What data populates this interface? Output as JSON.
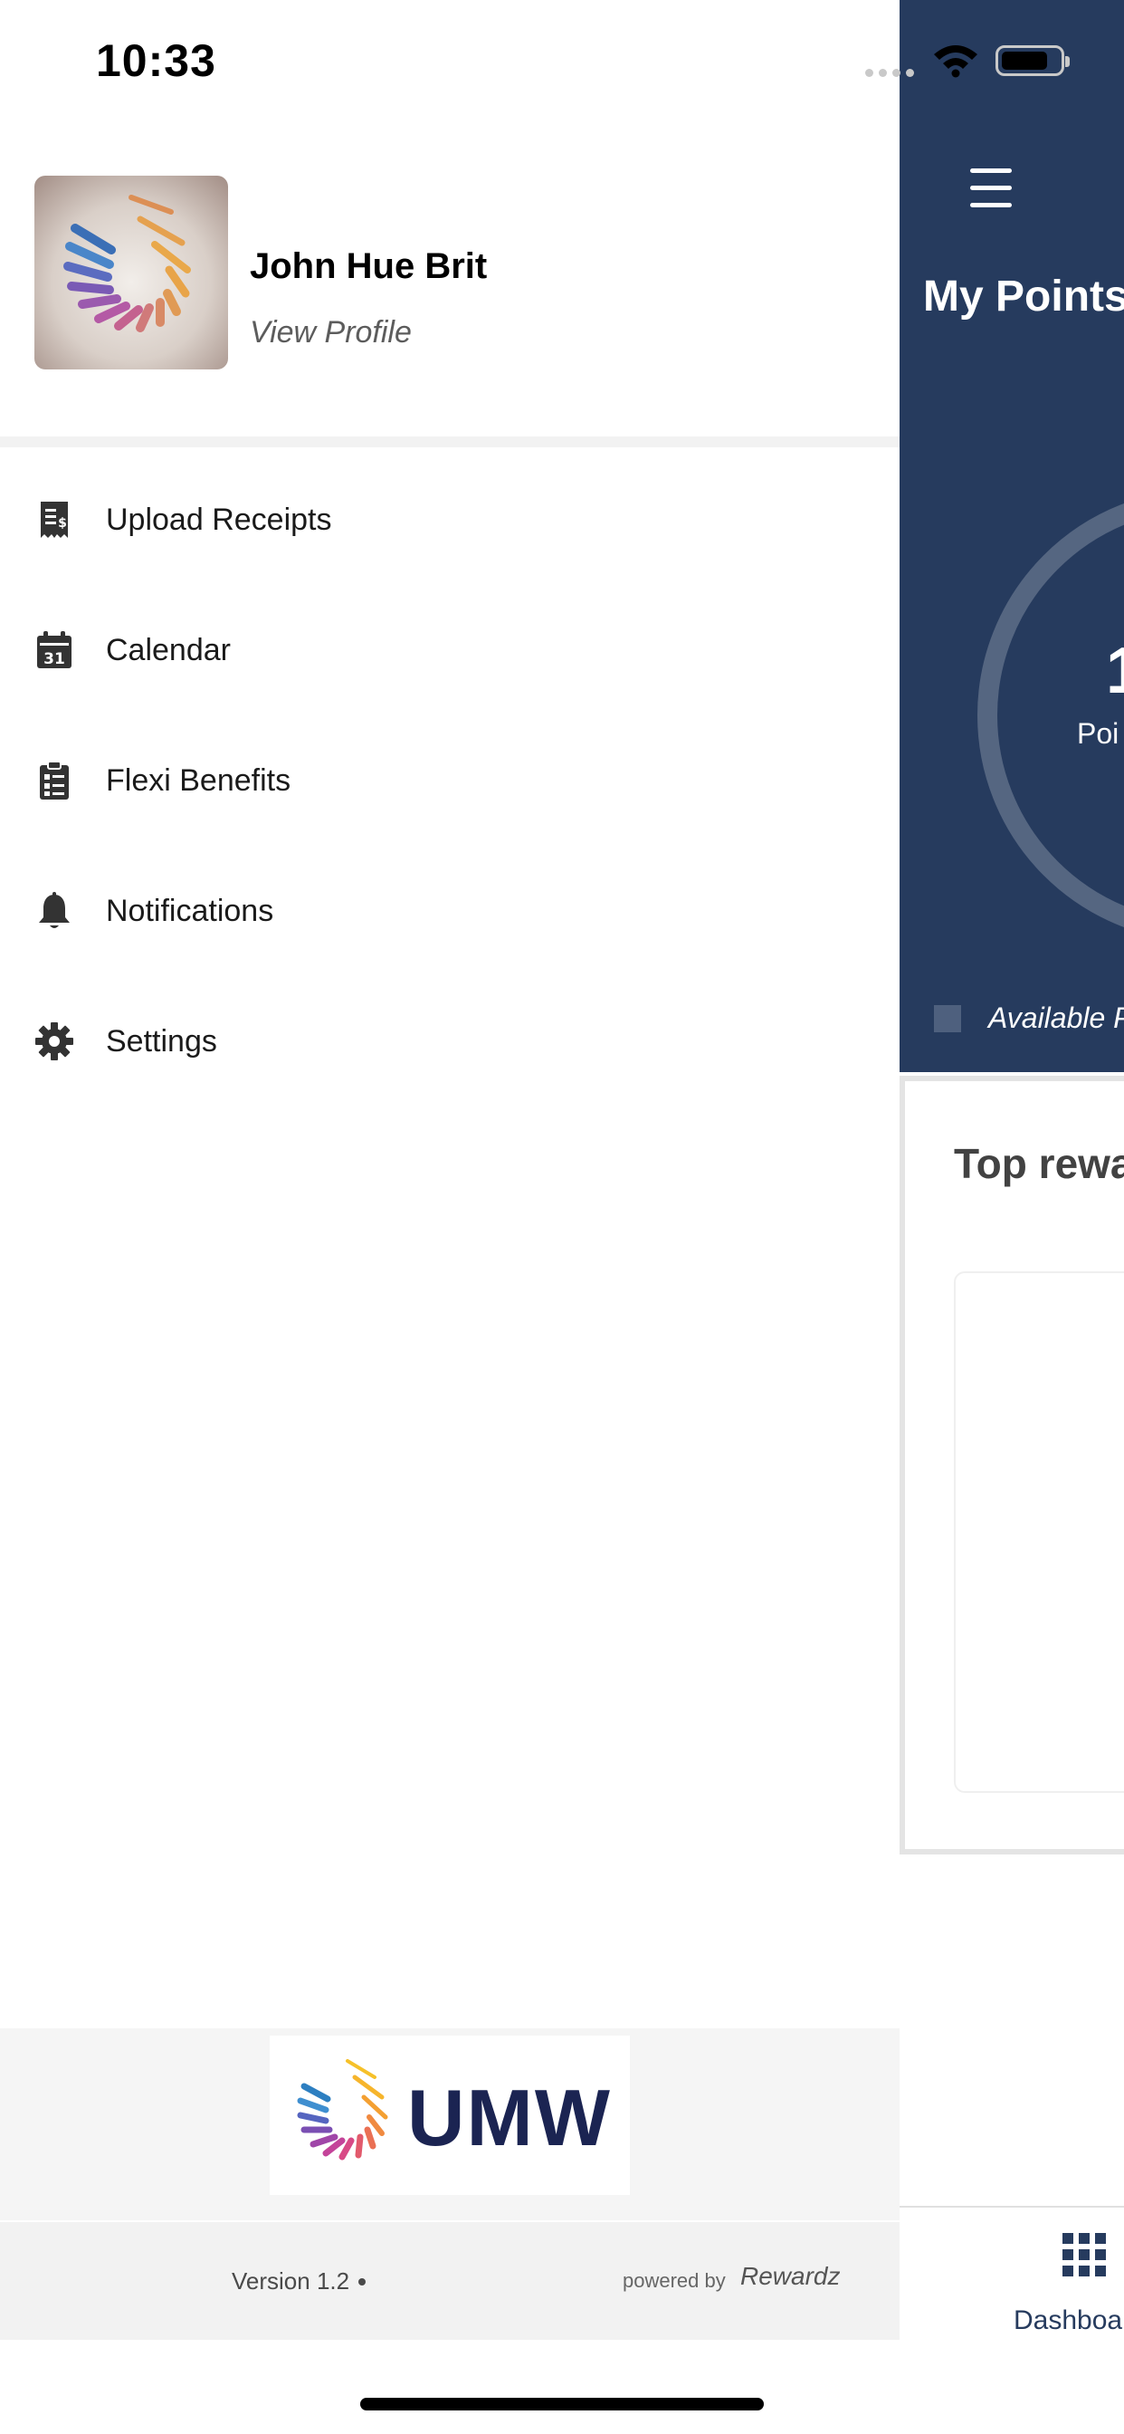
{
  "status_bar": {
    "time": "10:33"
  },
  "drawer": {
    "profile": {
      "name": "John Hue Brit",
      "link": "View Profile"
    },
    "menu": [
      {
        "label": "Upload Receipts",
        "icon": "receipt-icon"
      },
      {
        "label": "Calendar",
        "icon": "calendar-icon",
        "icon_text": "31"
      },
      {
        "label": "Flexi Benefits",
        "icon": "checklist-icon"
      },
      {
        "label": "Notifications",
        "icon": "bell-icon"
      },
      {
        "label": "Settings",
        "icon": "gear-icon"
      }
    ],
    "footer": {
      "logo_text": "UMW",
      "version": "Version 1.2",
      "powered_by": "powered by",
      "powered_brand": "Rewardz"
    }
  },
  "background_app": {
    "title": "My Points",
    "points_value": "1",
    "points_label": "Poi",
    "legend_label": "Available P",
    "section_title": "Top rewa",
    "tab_label": "Dashboa"
  },
  "colors": {
    "header_navy": "#263b5e",
    "logo_navy": "#1b2452",
    "icon_dark": "#333333"
  }
}
